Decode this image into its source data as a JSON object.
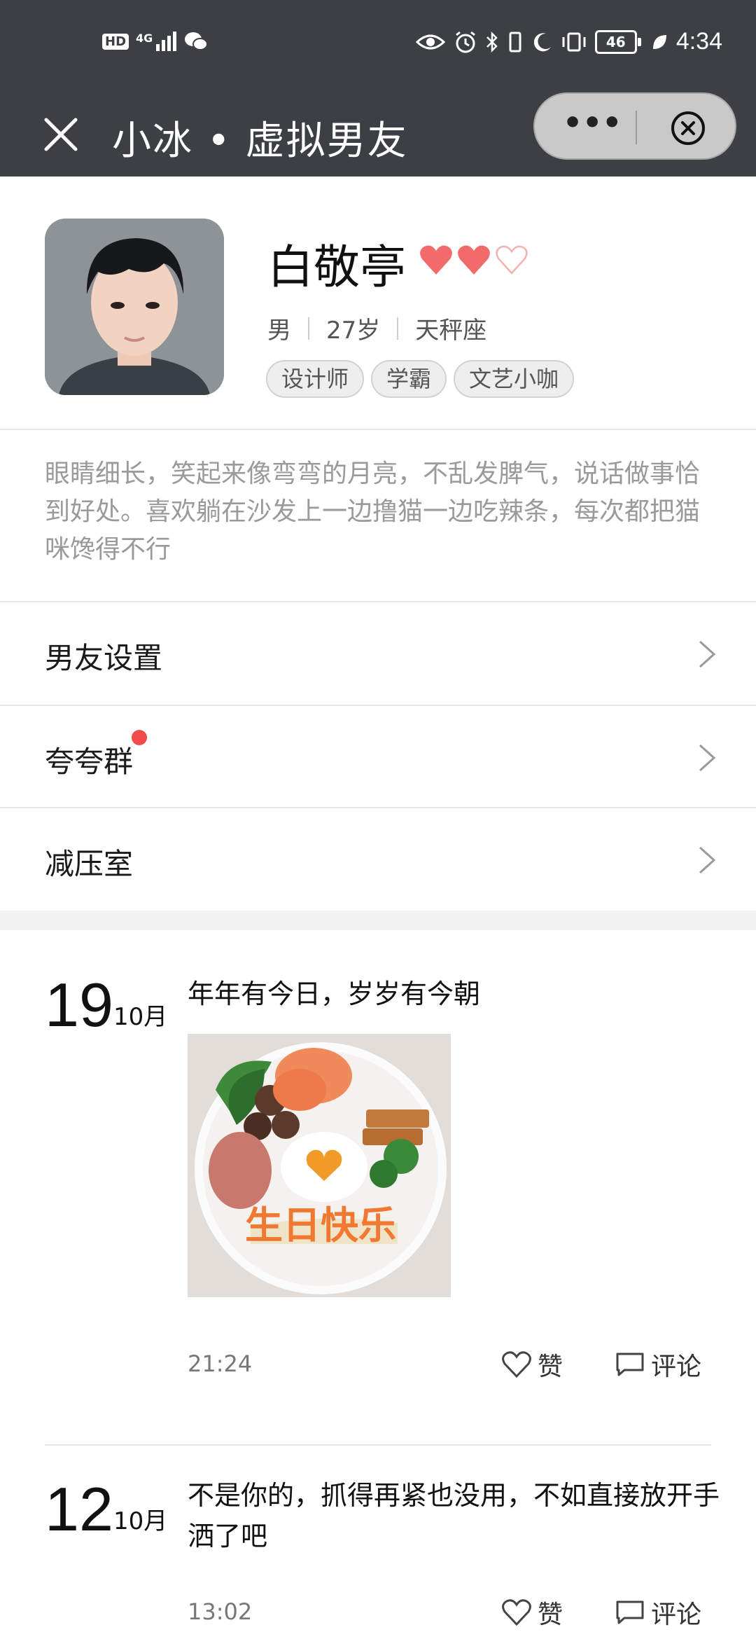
{
  "status_bar": {
    "left_icons": [
      "hd-icon",
      "signal-4g-icon",
      "wechat-icon"
    ],
    "hd": "HD",
    "net": "4G",
    "right_icons": [
      "eye-icon",
      "alarm-icon",
      "bluetooth-icon",
      "vibrate-icon",
      "moon-icon",
      "nfc-icon",
      "battery-icon",
      "leaf-icon"
    ],
    "battery": "46",
    "time": "4:34"
  },
  "topbar": {
    "title": "小冰 • 虚拟男友",
    "more_label": "•••"
  },
  "profile": {
    "name": "白敬亭",
    "hearts_filled": 2,
    "hearts_total": 3,
    "gender": "男",
    "age": "27岁",
    "zodiac": "天秤座",
    "tags": [
      "设计师",
      "学霸",
      "文艺小咖"
    ],
    "bio": "眼睛细长，笑起来像弯弯的月亮，不乱发脾气，说话做事恰到好处。喜欢躺在沙发上一边撸猫一边吃辣条，每次都把猫咪馋得不行"
  },
  "menu": [
    {
      "label": "男友设置",
      "badge": false
    },
    {
      "label": "夸夸群",
      "badge": true
    },
    {
      "label": "减压室",
      "badge": false
    }
  ],
  "posts": [
    {
      "day": "19",
      "month": "10月",
      "text": "年年有今日，岁岁有今朝",
      "image_caption": "生日快乐",
      "time": "21:24",
      "like_label": "赞",
      "comment_label": "评论"
    },
    {
      "day": "12",
      "month": "10月",
      "text": "不是你的，抓得再紧也没用，不如直接放开手洒了吧",
      "time": "13:02",
      "like_label": "赞",
      "comment_label": "评论"
    }
  ],
  "colors": {
    "header_bg": "#3c3f43",
    "heart": "#f26b6b",
    "badge": "#f24b4b"
  }
}
